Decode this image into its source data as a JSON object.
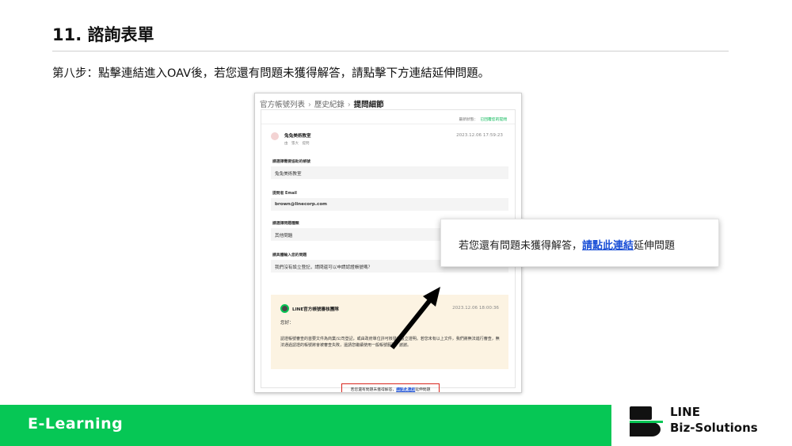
{
  "slide": {
    "title": "11. 諮詢表單",
    "step": "第八步：點擊連結進入OAV後，若您還有問題未獲得解答，請點擊下方連結延伸問題。"
  },
  "screenshot": {
    "breadcrumb": [
      "官方帳號列表",
      "歷史紀錄",
      "提問細節"
    ],
    "status_label": "最新狀態：",
    "status_value": "已回覆您的提問",
    "sender": {
      "name": "兔兔美術教室",
      "meta": "由　張大　提問",
      "time": "2023.12.06 17:59:23"
    },
    "fields": [
      {
        "label": "請選擇需要協助的帳號",
        "value": "兔兔美術教室"
      },
      {
        "label": "提問者 Email",
        "value": "brown@linecorp.com"
      },
      {
        "label": "請選擇問題種類",
        "value": "其他問題"
      },
      {
        "label": "請具體輸入您的問題",
        "value": "我們沒有設立登記，請問還可以申請認證帳號嗎？"
      }
    ],
    "reply": {
      "name": "LINE官方帳號審核團隊",
      "time": "2023.12.06 18:00:36",
      "greeting": "您好：",
      "body": "認證帳號審查的首要文件為商業/公司登記，或由政府單位許可核發的設立證明。若您未有以上文件，我們將無法進行審查，無法通過認證的帳號將會被審查失敗，還請您繼續使用一般帳號服務，謝謝。"
    },
    "link_prefix": "若您還有問題未獲得解答，",
    "link_text": "請點此連結",
    "link_suffix": "延伸問題"
  },
  "callout": {
    "prefix": "若您還有問題未獲得解答，",
    "link_text": "請點此連結",
    "suffix": "延伸問題"
  },
  "footer": {
    "label": "E-Learning"
  },
  "brand": {
    "line1": "LINE",
    "line2": "Biz-Solutions"
  },
  "colors": {
    "accent_green": "#06c755",
    "link_blue": "#1a4fd6",
    "highlight_red": "#d9271f"
  }
}
